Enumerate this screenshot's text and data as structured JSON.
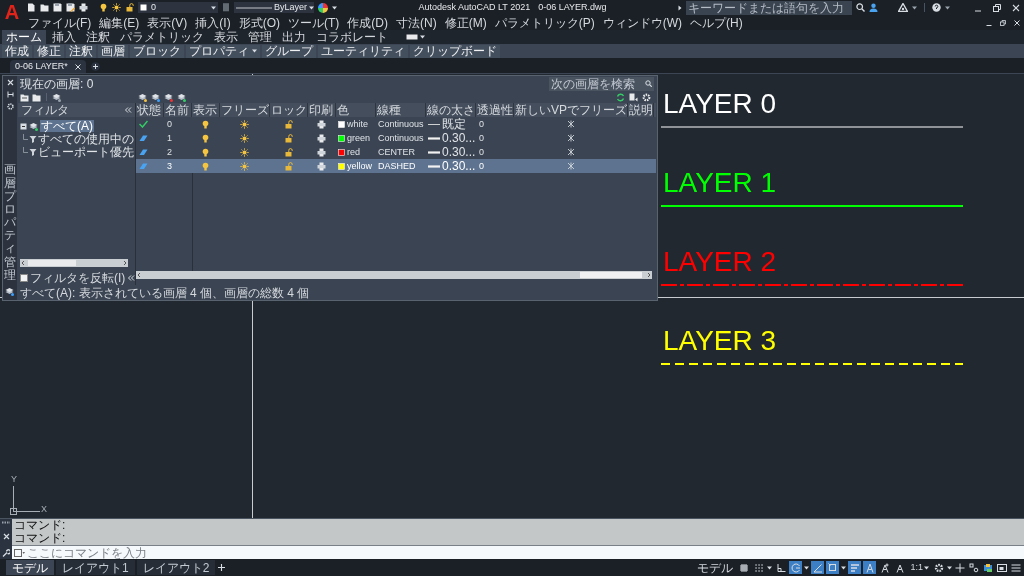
{
  "title_bar": {
    "app_letter": "A",
    "layer_dropdown": "0",
    "linetype_dropdown": "ByLayer",
    "title": "Autodesk AutoCAD LT 2021",
    "file_name": "0-06 LAYER.dwg",
    "search": {
      "placeholder": "キーワードまたは語句を入力"
    }
  },
  "menu_bar": [
    "ファイル(F)",
    "編集(E)",
    "表示(V)",
    "挿入(I)",
    "形式(O)",
    "ツール(T)",
    "作成(D)",
    "寸法(N)",
    "修正(M)",
    "パラメトリック(P)",
    "ウィンドウ(W)",
    "ヘルプ(H)"
  ],
  "ribbon_tabs": [
    {
      "label": "ホーム",
      "selected": true
    },
    {
      "label": "挿入",
      "selected": false
    },
    {
      "label": "注釈",
      "selected": false
    },
    {
      "label": "パラメトリック",
      "selected": false
    },
    {
      "label": "表示",
      "selected": false
    },
    {
      "label": "管理",
      "selected": false
    },
    {
      "label": "出力",
      "selected": false
    },
    {
      "label": "コラボレート",
      "selected": false
    }
  ],
  "ribbon_panels": [
    {
      "label": "作成",
      "caret": false
    },
    {
      "label": "修正",
      "caret": false
    },
    {
      "label": "注釈",
      "caret": false
    },
    {
      "label": "画層",
      "caret": false
    },
    {
      "label": "ブロック",
      "caret": false
    },
    {
      "label": "プロパティ",
      "caret": true
    },
    {
      "label": "グループ",
      "caret": false
    },
    {
      "label": "ユーティリティ",
      "caret": false
    },
    {
      "label": "クリップボード",
      "caret": false
    }
  ],
  "document_tabs": [
    {
      "label": "0-06 LAYER*",
      "selected": true
    }
  ],
  "layer_manager": {
    "side_title": "画層プロパティ管理",
    "current_layer": "現在の画層: 0",
    "search": {
      "placeholder": "次の画層を検索"
    },
    "filter_header": "フィルタ",
    "filters": [
      {
        "label": "すべて(A)",
        "selected": true,
        "children": [
          {
            "label": "すべての使用中の",
            "selected": false
          },
          {
            "label": "ビューポート優先",
            "selected": false
          }
        ]
      }
    ],
    "invert_filter": {
      "label": "フィルタを反転(I)",
      "checked": false
    },
    "columns": [
      "状態",
      "名前",
      "表示",
      "フリーズ",
      "ロック",
      "印刷",
      "色",
      "線種",
      "線の太さ",
      "透過性",
      "新しいVPでフリーズ",
      "説明"
    ],
    "rows": [
      {
        "current": true,
        "name": "0",
        "visible": true,
        "frozen": false,
        "locked": false,
        "plot": true,
        "color": "#ffffff",
        "color_name": "white",
        "linetype": "Continuous",
        "heavy": false,
        "lineweight": "既定",
        "transparency": "0",
        "selected": false
      },
      {
        "current": false,
        "name": "1",
        "visible": true,
        "frozen": false,
        "locked": false,
        "plot": true,
        "color": "#00ff00",
        "color_name": "green",
        "linetype": "Continuous",
        "heavy": true,
        "lineweight": "0.30...",
        "transparency": "0",
        "selected": false
      },
      {
        "current": false,
        "name": "2",
        "visible": true,
        "frozen": false,
        "locked": false,
        "plot": true,
        "color": "#ff0000",
        "color_name": "red",
        "linetype": "CENTER",
        "heavy": true,
        "lineweight": "0.30...",
        "transparency": "0",
        "selected": false
      },
      {
        "current": false,
        "name": "3",
        "visible": true,
        "frozen": false,
        "locked": false,
        "plot": true,
        "color": "#ffff00",
        "color_name": "yellow",
        "linetype": "DASHED",
        "heavy": true,
        "lineweight": "0.30...",
        "transparency": "0",
        "selected": true
      }
    ],
    "status": "すべて(A): 表示されている画層 4 個、画層の総数 4 個"
  },
  "canvas_text": [
    {
      "text": "LAYER 0",
      "color": "#ffffff",
      "kind": "solid"
    },
    {
      "text": "LAYER 1",
      "color": "#00ff00",
      "kind": "solid"
    },
    {
      "text": "LAYER 2",
      "color": "#ff0000",
      "kind": "center"
    },
    {
      "text": "LAYER 3",
      "color": "#ffff00",
      "kind": "dashed"
    }
  ],
  "ucs": {
    "y_label": "Y",
    "x_label": "X"
  },
  "command_line": {
    "history": [
      "コマンド:",
      "コマンド:"
    ],
    "placeholder": "ここにコマンドを入力"
  },
  "layout_tabs": [
    {
      "label": "モデル",
      "selected": true
    },
    {
      "label": "レイアウト1",
      "selected": false
    },
    {
      "label": "レイアウト2",
      "selected": false
    }
  ],
  "status_bar": {
    "model_label": "モデル",
    "annotation_scale": "1:1",
    "toggles": [
      {
        "kind": "grid",
        "on": false,
        "caret": false
      },
      {
        "kind": "snap",
        "on": false,
        "caret": true
      },
      {
        "kind": "ortho",
        "on": false,
        "caret": false
      },
      {
        "kind": "polar",
        "on": true,
        "caret": true
      },
      {
        "kind": "isodraft",
        "on": true,
        "caret": false
      },
      {
        "kind": "osnap",
        "on": true,
        "caret": true
      },
      {
        "kind": "lineweight",
        "on": true,
        "caret": false
      },
      {
        "kind": "annotation",
        "on": true,
        "caret": false
      },
      {
        "kind": "autoscale",
        "on": false,
        "caret": false
      },
      {
        "kind": "annoscale",
        "on": false,
        "caret": false
      }
    ],
    "tools": [
      {
        "kind": "gear",
        "caret": true
      },
      {
        "kind": "plus",
        "caret": false
      },
      {
        "kind": "isolate",
        "caret": false
      },
      {
        "kind": "hardware",
        "caret": false
      },
      {
        "kind": "window",
        "caret": false
      },
      {
        "kind": "menu",
        "caret": false
      }
    ]
  }
}
